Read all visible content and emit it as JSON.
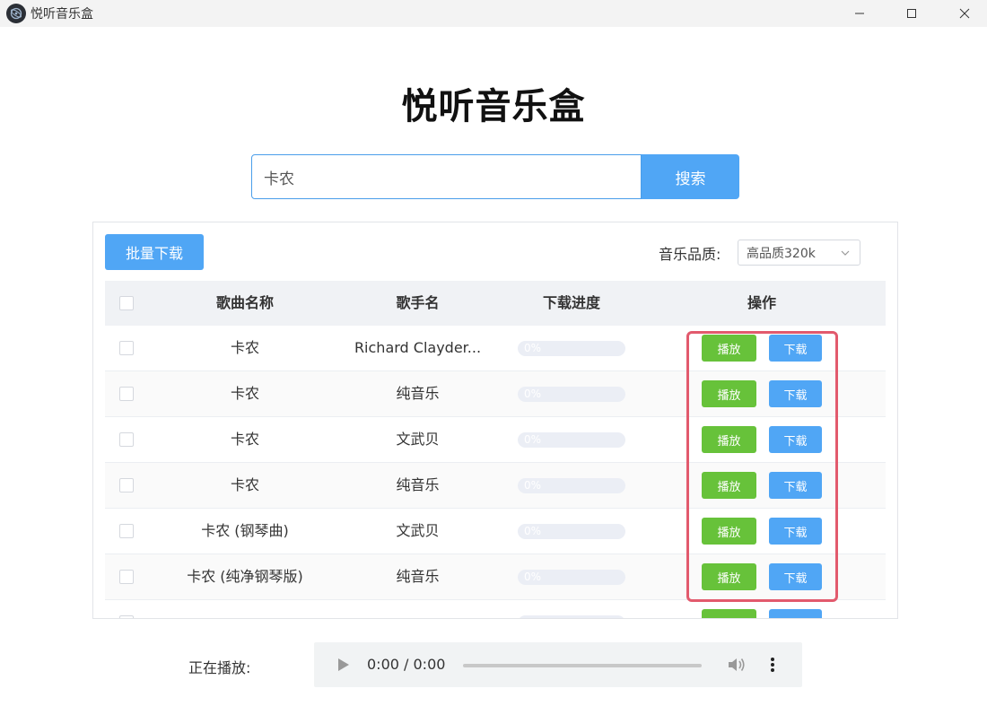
{
  "window": {
    "title": "悦听音乐盒"
  },
  "header": {
    "title": "悦听音乐盒"
  },
  "search": {
    "value": "卡农",
    "button_label": "搜索"
  },
  "toolbar": {
    "batch_download_label": "批量下载",
    "quality_label": "音乐品质:",
    "quality_value": "高品质320k"
  },
  "table": {
    "headers": {
      "name": "歌曲名称",
      "artist": "歌手名",
      "progress": "下载进度",
      "actions": "操作"
    },
    "play_label": "播放",
    "download_label": "下载",
    "rows": [
      {
        "name": "卡农",
        "artist": "Richard Clayder...",
        "progress": 0,
        "progress_text": "0%"
      },
      {
        "name": "卡农",
        "artist": "纯音乐",
        "progress": 0,
        "progress_text": "0%"
      },
      {
        "name": "卡农",
        "artist": "文武贝",
        "progress": 0,
        "progress_text": "0%"
      },
      {
        "name": "卡农",
        "artist": "纯音乐",
        "progress": 0,
        "progress_text": "0%"
      },
      {
        "name": "卡农 (钢琴曲)",
        "artist": "文武贝",
        "progress": 0,
        "progress_text": "0%"
      },
      {
        "name": "卡农 (纯净钢琴版)",
        "artist": "纯音乐",
        "progress": 0,
        "progress_text": "0%"
      },
      {
        "name": "",
        "artist": "",
        "progress": 0,
        "progress_text": ""
      }
    ]
  },
  "player": {
    "label": "正在播放:",
    "time": "0:00 / 0:00"
  },
  "colors": {
    "accent": "#50a6f5",
    "play": "#67c23a",
    "highlight": "#e25a6d"
  }
}
